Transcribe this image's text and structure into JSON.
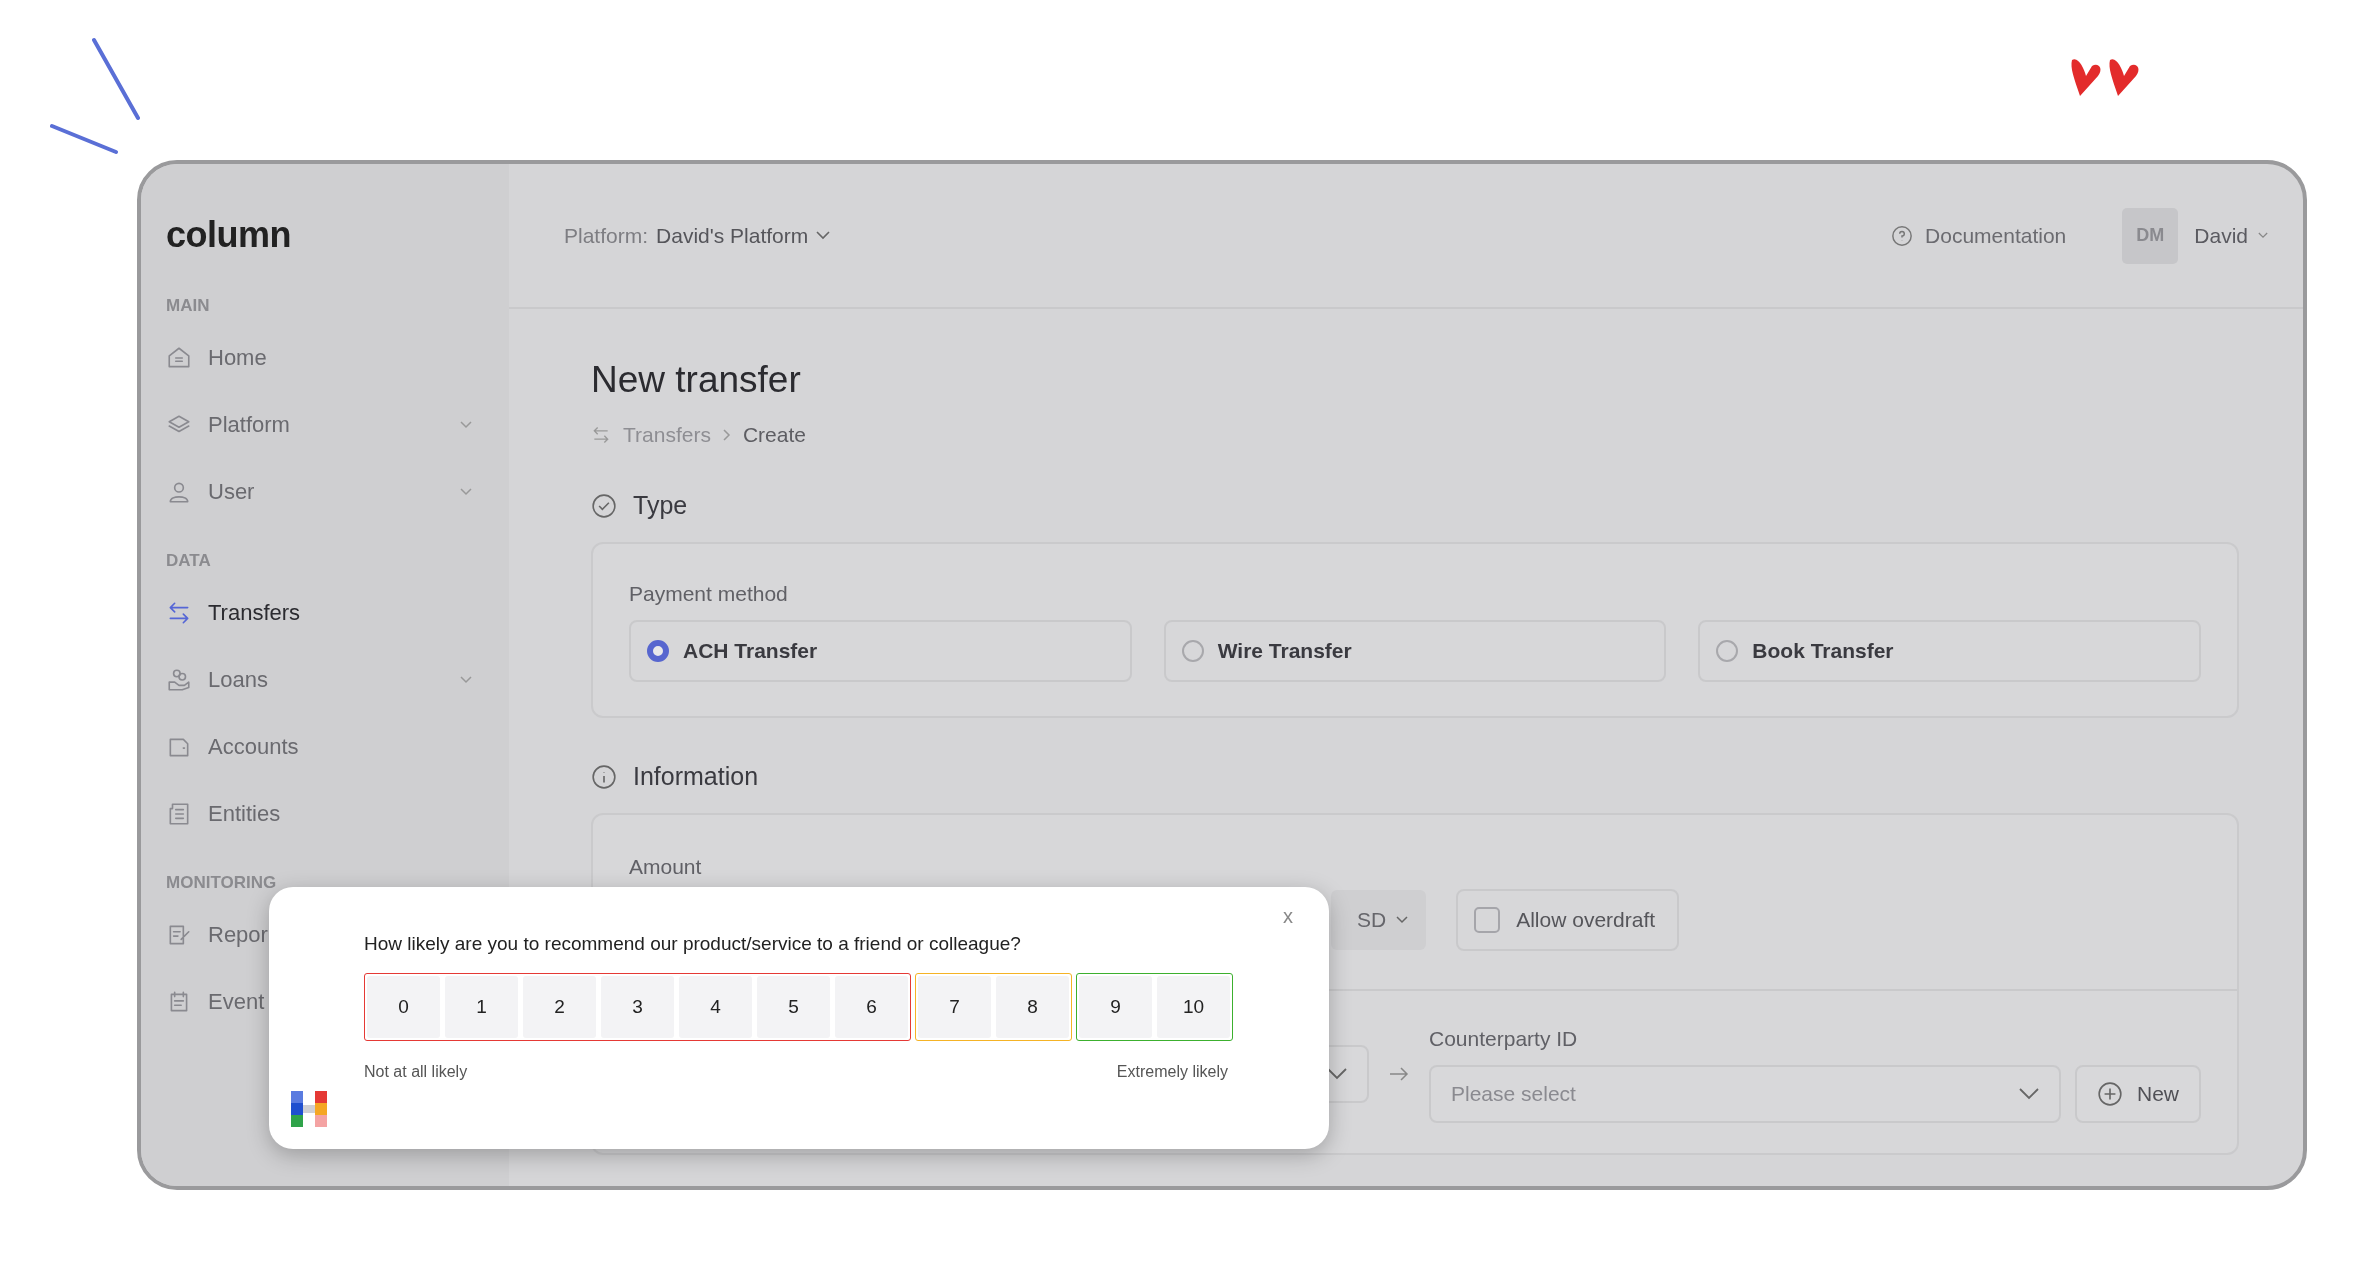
{
  "logo": "column",
  "sidebar": {
    "sections": [
      {
        "title": "MAIN",
        "items": [
          {
            "label": "Home",
            "selected": false,
            "expandable": false
          },
          {
            "label": "Platform",
            "selected": false,
            "expandable": true
          },
          {
            "label": "User",
            "selected": false,
            "expandable": true
          }
        ]
      },
      {
        "title": "DATA",
        "items": [
          {
            "label": "Transfers",
            "selected": true,
            "expandable": false
          },
          {
            "label": "Loans",
            "selected": false,
            "expandable": true
          },
          {
            "label": "Accounts",
            "selected": false,
            "expandable": false
          },
          {
            "label": "Entities",
            "selected": false,
            "expandable": false
          }
        ]
      },
      {
        "title": "MONITORING",
        "items": [
          {
            "label": "Repor",
            "selected": false
          },
          {
            "label": "Event",
            "selected": false
          }
        ]
      }
    ]
  },
  "topbar": {
    "platform_label": "Platform:",
    "platform_name": "David's Platform",
    "documentation": "Documentation",
    "avatar_initials": "DM",
    "user_name": "David"
  },
  "page": {
    "title": "New transfer",
    "breadcrumb": [
      "Transfers",
      "Create"
    ],
    "type_section": {
      "title": "Type",
      "payment_method_label": "Payment method",
      "options": [
        {
          "label": "ACH Transfer",
          "selected": true
        },
        {
          "label": "Wire Transfer",
          "selected": false
        },
        {
          "label": "Book Transfer",
          "selected": false
        }
      ]
    },
    "information_section": {
      "title": "Information",
      "amount_label": "Amount",
      "currency": "SD",
      "allow_overdraft": {
        "label": "Allow overdraft",
        "checked": false
      },
      "counterparty_label": "Counterparty ID",
      "counterparty_placeholder": "Please select",
      "new_button": "New"
    }
  },
  "survey": {
    "close": "x",
    "question": "How likely are you to recommend our product/service to a friend or colleague?",
    "groups": [
      {
        "color": "#e53935",
        "scores": [
          "0",
          "1",
          "2",
          "3",
          "4",
          "5",
          "6"
        ]
      },
      {
        "color": "#f5b325",
        "scores": [
          "7",
          "8"
        ]
      },
      {
        "color": "#3cb02e",
        "scores": [
          "9",
          "10"
        ]
      }
    ],
    "low_label": "Not at all likely",
    "high_label": "Extremely likely"
  }
}
